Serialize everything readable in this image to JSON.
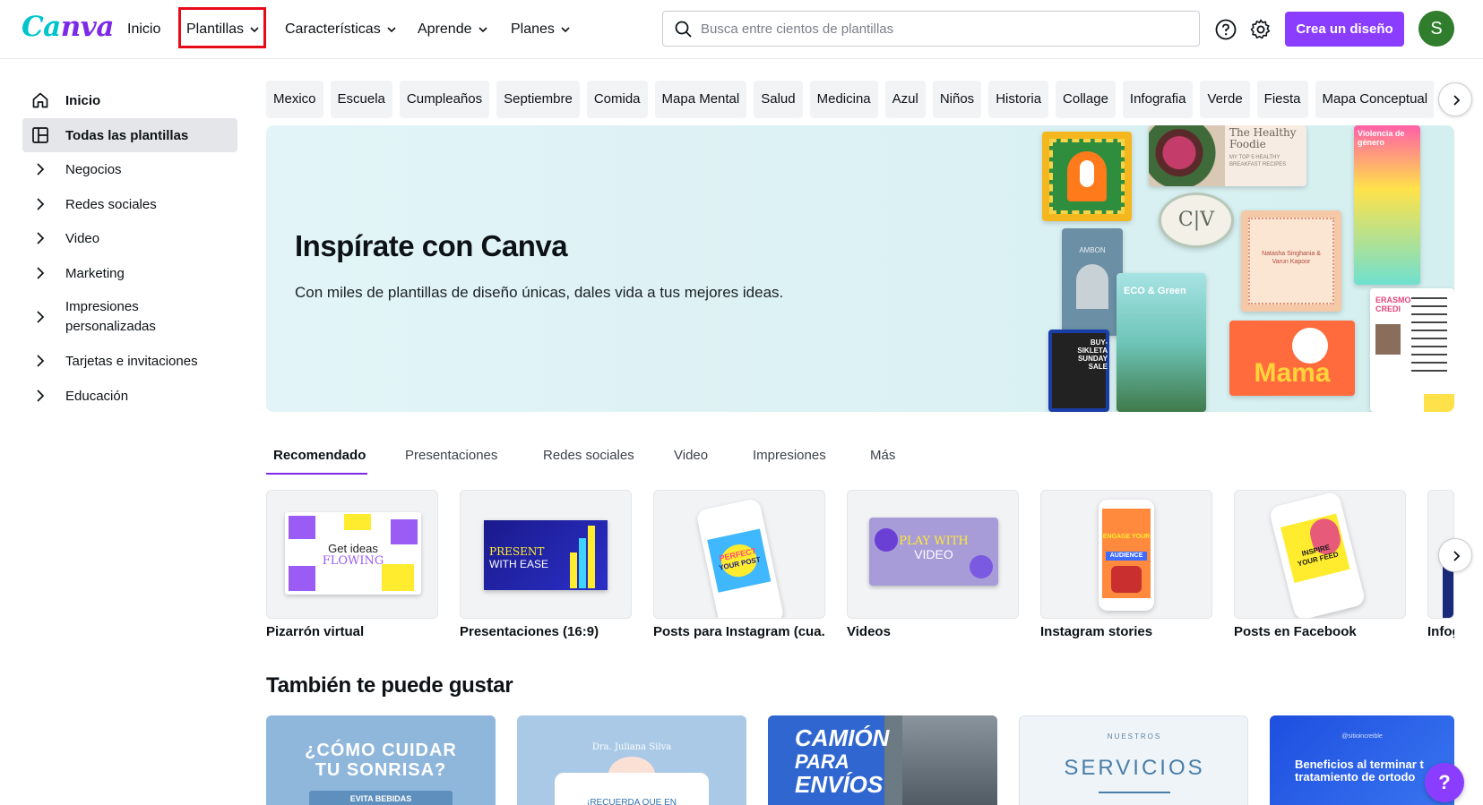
{
  "brand": {
    "logo_text": "Canva",
    "accent": "#8b3dff",
    "logo_gradient": [
      "#00c4cc",
      "#7d2ae8"
    ]
  },
  "header": {
    "nav": [
      {
        "label": "Inicio",
        "has_chevron": false
      },
      {
        "label": "Plantillas",
        "has_chevron": true,
        "highlighted": true
      },
      {
        "label": "Características",
        "has_chevron": true
      },
      {
        "label": "Aprende",
        "has_chevron": true
      },
      {
        "label": "Planes",
        "has_chevron": true
      }
    ],
    "search_placeholder": "Busca entre cientos de plantillas",
    "create_button": "Crea un diseño",
    "avatar_initial": "S",
    "avatar_color": "#2f7d2d"
  },
  "sidebar": {
    "items": [
      {
        "label": "Inicio",
        "icon": "home-icon"
      },
      {
        "label": "Todas las plantillas",
        "icon": "templates-icon"
      },
      {
        "label": "Negocios",
        "icon": "chevron-right-icon"
      },
      {
        "label": "Redes sociales",
        "icon": "chevron-right-icon"
      },
      {
        "label": "Video",
        "icon": "chevron-right-icon"
      },
      {
        "label": "Marketing",
        "icon": "chevron-right-icon"
      },
      {
        "label": "Impresiones personalizadas",
        "icon": "chevron-right-icon"
      },
      {
        "label": "Tarjetas e invitaciones",
        "icon": "chevron-right-icon"
      },
      {
        "label": "Educación",
        "icon": "chevron-right-icon"
      }
    ]
  },
  "chips": [
    "Mexico",
    "Escuela",
    "Cumpleaños",
    "Septiembre",
    "Comida",
    "Mapa Mental",
    "Salud",
    "Medicina",
    "Azul",
    "Niños",
    "Historia",
    "Collage",
    "Infografia",
    "Verde",
    "Fiesta",
    "Mapa Conceptual"
  ],
  "hero": {
    "title": "Inspírate con Canva",
    "subtitle": "Con miles de plantillas de diseño únicas, dales vida a tus mejores ideas.",
    "collage": {
      "healthy_title": "The Healthy Foodie",
      "healthy_sub": "MY TOP 5 HEALTHY BREAKFAST RECIPES",
      "monogram": "C|V",
      "amber_name": "AMBON",
      "eco_title": "ECO & Green",
      "wedding_names": "Natasha Singhania & Varun Kapoor",
      "mama": "Mama",
      "bike_text": "BUY-SIKLETA SUNDAY SALE",
      "genero_title": "Violencia de género",
      "resume_name": "ERASMO CREDI"
    }
  },
  "tabs": [
    "Recomendado",
    "Presentaciones",
    "Redes sociales",
    "Video",
    "Impresiones",
    "Más"
  ],
  "categories": [
    {
      "label": "Pizarrón virtual",
      "thumb_text": [
        "Get ideas",
        "FLOWING"
      ]
    },
    {
      "label": "Presentaciones (16:9)",
      "thumb_text": [
        "PRESENT",
        "WITH EASE"
      ]
    },
    {
      "label": "Posts para Instagram (cua...",
      "thumb_text": [
        "PERFECT",
        "YOUR POST"
      ]
    },
    {
      "label": "Videos",
      "thumb_text": [
        "PLAY WITH",
        "VIDEO"
      ]
    },
    {
      "label": "Instagram stories",
      "thumb_text": [
        "ENGAGE YOUR",
        "AUDIENCE"
      ]
    },
    {
      "label": "Posts en Facebook",
      "thumb_text": [
        "INSPIRE",
        "YOUR FEED"
      ]
    },
    {
      "label": "Infog",
      "thumb_text": []
    }
  ],
  "also_like": {
    "title": "También te puede gustar",
    "items": [
      {
        "lines": [
          "¿CÓMO CUIDAR",
          "TU SONRISA?"
        ],
        "badge": "EVITA BEBIDAS"
      },
      {
        "lines": [
          "Dra. Juliana Silva"
        ],
        "badge": "¡RECUERDA QUE EN"
      },
      {
        "lines": [
          "CAMIÓN",
          "PARA",
          "ENVÍOS"
        ]
      },
      {
        "lines": [
          "NUESTROS",
          "SERVICIOS"
        ]
      },
      {
        "lines": [
          "@sitioincreible",
          "Beneficios al terminar t",
          "tratamiento de ortodo"
        ]
      }
    ]
  },
  "help_button": "?"
}
